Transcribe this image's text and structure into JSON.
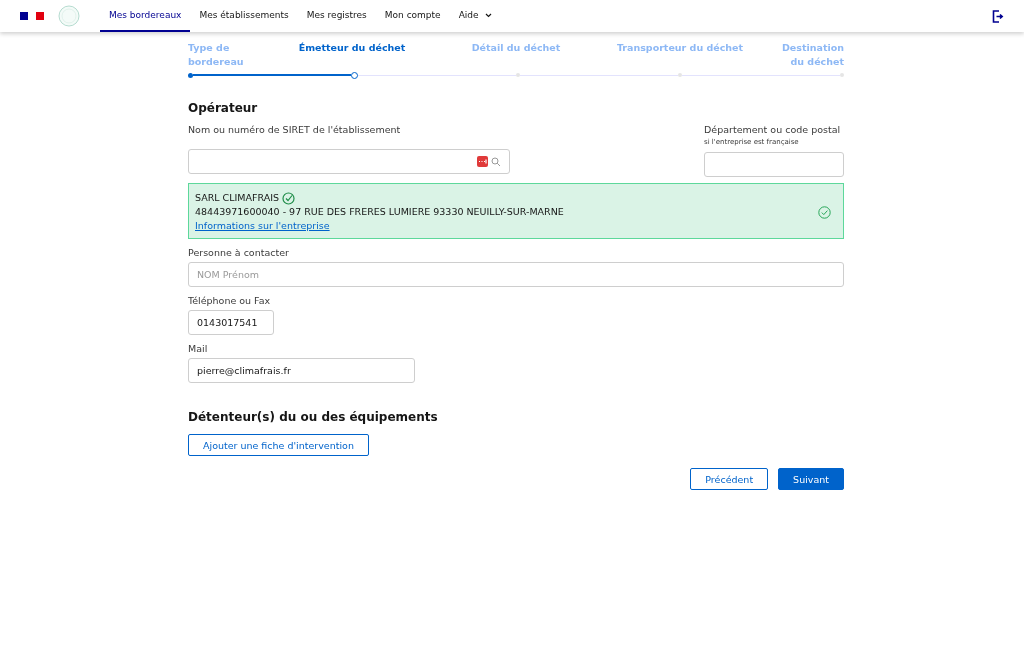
{
  "nav": {
    "items": [
      {
        "label": "Mes bordereaux",
        "selected": true
      },
      {
        "label": "Mes établissements",
        "selected": false
      },
      {
        "label": "Mes registres",
        "selected": false
      },
      {
        "label": "Mon compte",
        "selected": false
      },
      {
        "label": "Aide",
        "selected": false,
        "kind": "dropdown"
      }
    ]
  },
  "stepper": {
    "steps": [
      {
        "label": "Type de bordereau",
        "done": true,
        "selected": false
      },
      {
        "label": "Émetteur du déchet",
        "done": false,
        "selected": true
      },
      {
        "label": "Détail du déchet",
        "done": false,
        "selected": false
      },
      {
        "label": "Transporteur du déchet",
        "done": false,
        "selected": false
      },
      {
        "label": "Destination du déchet",
        "done": false,
        "selected": false
      }
    ]
  },
  "operator": {
    "title": "Opérateur",
    "siret_label": "Nom ou numéro de SIRET de l'établissement",
    "dept_label": "Département ou code postal",
    "dept_hint": "si l'entreprise est française",
    "company": {
      "name": "SARL CLIMAFRAIS",
      "details": "48443971600040 - 97 RUE DES FRERES LUMIERE 93330 NEUILLY-SUR-MARNE",
      "link": "Informations sur l'entreprise",
      "selected": true
    },
    "contact_label": "Personne à contacter",
    "contact_placeholder": "NOM Prénom",
    "phone_label": "Téléphone ou Fax",
    "phone_value": "0143017541",
    "mail_label": "Mail",
    "mail_value": "pierre@climafrais.fr"
  },
  "holders": {
    "title": "Détenteur(s) du ou des équipements",
    "add_button": "Ajouter une fiche d'intervention"
  },
  "buttons": {
    "previous": "Précédent",
    "next": "Suivant"
  }
}
